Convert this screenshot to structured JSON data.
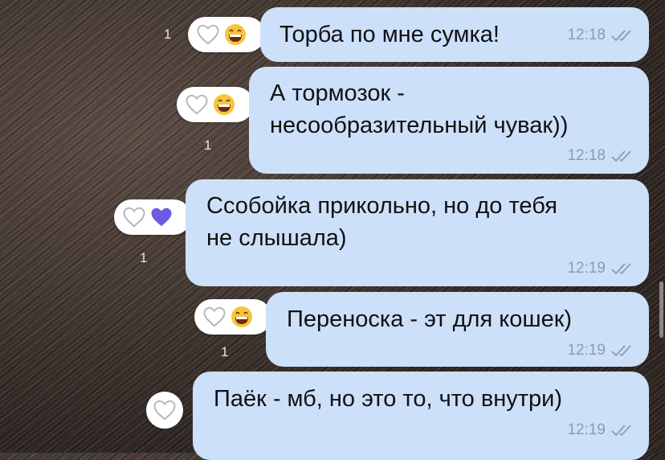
{
  "messages": [
    {
      "text": "Торба по мне сумка!",
      "time": "12:18",
      "reaction": "laugh-emoji",
      "count": "1"
    },
    {
      "text": "А тормозок -\nнесообразительный чувак))",
      "time": "12:18",
      "reaction": "laugh-emoji",
      "count": "1"
    },
    {
      "text": "Ссобойка прикольно, но до тебя\nне слышала)",
      "time": "12:19",
      "reaction": "purple-heart",
      "count": "1"
    },
    {
      "text": "Переноска - эт для кошек)",
      "time": "12:19",
      "reaction": "laugh-emoji",
      "count": "1"
    },
    {
      "text": "Паёк - мб, но это то, что внутри)",
      "time": "12:19",
      "reaction": "none",
      "count": ""
    }
  ],
  "colors": {
    "bubble": "#cde0fa",
    "meta": "#8a9bb2",
    "purple_heart": "#6b5ce0"
  },
  "icons": [
    "heart-outline-icon",
    "laugh-emoji-icon",
    "purple-heart-icon",
    "double-check-icon"
  ]
}
